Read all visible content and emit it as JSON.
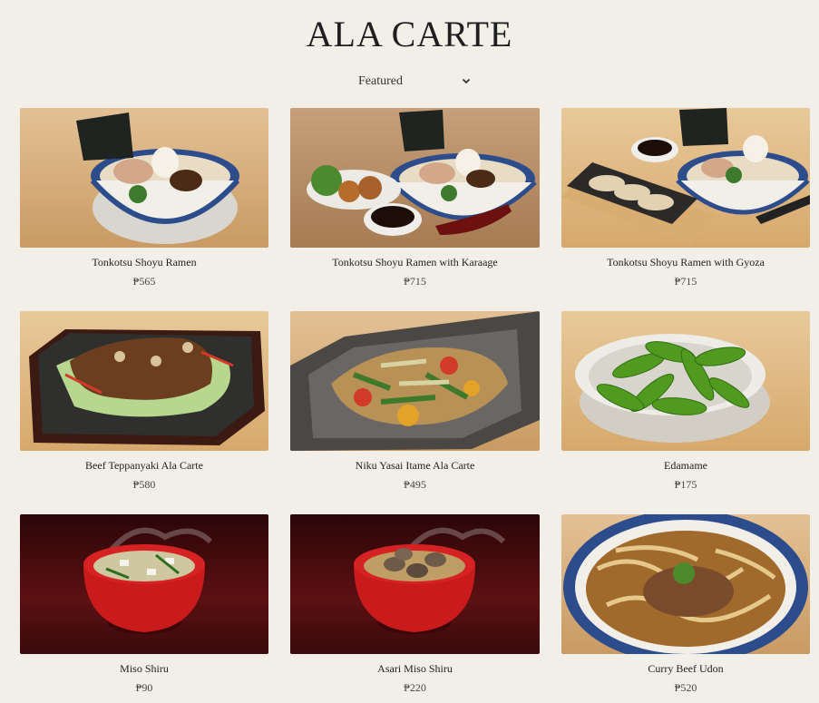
{
  "header": {
    "title": "ALA CARTE"
  },
  "sort": {
    "selected": "Featured"
  },
  "currency": "₱",
  "items": [
    {
      "name": "Tonkotsu Shoyu Ramen",
      "price": "₱565",
      "image_icon": "ramen-bowl-icon"
    },
    {
      "name": "Tonkotsu Shoyu Ramen with Karaage",
      "price": "₱715",
      "image_icon": "ramen-karaage-icon"
    },
    {
      "name": "Tonkotsu Shoyu Ramen with Gyoza",
      "price": "₱715",
      "image_icon": "ramen-gyoza-icon"
    },
    {
      "name": "Beef Teppanyaki Ala Carte",
      "price": "₱580",
      "image_icon": "teppanyaki-plate-icon"
    },
    {
      "name": "Niku Yasai Itame Ala Carte",
      "price": "₱495",
      "image_icon": "stir-fry-plate-icon"
    },
    {
      "name": "Edamame",
      "price": "₱175",
      "image_icon": "edamame-bowl-icon"
    },
    {
      "name": "Miso Shiru",
      "price": "₱90",
      "image_icon": "miso-soup-icon"
    },
    {
      "name": "Asari Miso Shiru",
      "price": "₱220",
      "image_icon": "clam-miso-soup-icon"
    },
    {
      "name": "Curry Beef Udon",
      "price": "₱520",
      "image_icon": "udon-bowl-icon"
    }
  ],
  "colors": {
    "background": "#f1efe8",
    "text": "#222222"
  }
}
